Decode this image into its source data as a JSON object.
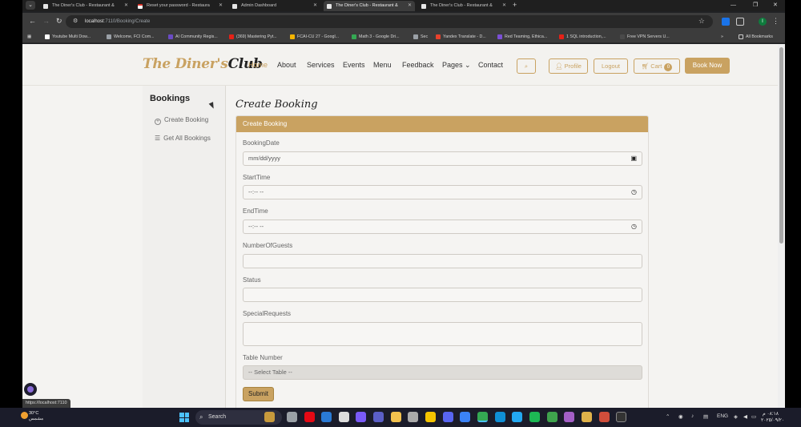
{
  "browser": {
    "tabs": [
      {
        "title": "The Diner's Club - Restaurant &",
        "active": false,
        "favicon": "doc-icon"
      },
      {
        "title": "Reset your password - Restaura",
        "active": false,
        "favicon": "gmail-icon"
      },
      {
        "title": "Admin Dashboard",
        "active": false,
        "favicon": "doc-icon"
      },
      {
        "title": "The Diner's Club - Restaurant &",
        "active": true,
        "favicon": "doc-icon"
      },
      {
        "title": "The Diner's Club - Restaurant &",
        "active": false,
        "favicon": "doc-icon"
      }
    ],
    "url_host": "localhost",
    "url_rest": ":7110/Booking/Create",
    "profile_initial": "I",
    "bookmarks": [
      {
        "label": "Youtube Multi Dow...",
        "color": "#ffffff"
      },
      {
        "label": "Welcome, FCI Com...",
        "color": "#9aa0a6"
      },
      {
        "label": "AI Community Regis...",
        "color": "#6a4bc4"
      },
      {
        "label": "(369) Mastering Pyt...",
        "color": "#e62117"
      },
      {
        "label": "FCAI-CU 27 - Googl...",
        "color": "#f4b400"
      },
      {
        "label": "Math 3 - Google Dri...",
        "color": "#34a853"
      },
      {
        "label": "Sec",
        "color": "#9aa0a6"
      },
      {
        "label": "Yandex Translate - D...",
        "color": "#e8412c"
      },
      {
        "label": "Red Teaming, Ethica...",
        "color": "#7b4fd6"
      },
      {
        "label": "1 SQL introduction,...",
        "color": "#e62117"
      },
      {
        "label": "Free VPN Servers U...",
        "color": "#4a4a4a"
      }
    ],
    "all_bookmarks": "All Bookmarks",
    "status_url": "https://localhost:7110"
  },
  "site": {
    "logo_gold": "The Diner's",
    "logo_dark": "Club",
    "nav": [
      {
        "label": "Home",
        "active": true
      },
      {
        "label": "About",
        "active": false
      },
      {
        "label": "Services",
        "active": false
      },
      {
        "label": "Events",
        "active": false
      },
      {
        "label": "Menu",
        "active": false
      },
      {
        "label": "Feedback",
        "active": false
      },
      {
        "label": "Pages",
        "active": false
      },
      {
        "label": "Contact",
        "active": false
      }
    ],
    "profile": "Profile",
    "logout": "Logout",
    "cart": "Cart",
    "cart_count": "0",
    "book_now": "Book Now",
    "accent": "#c9a261"
  },
  "sidebar": {
    "title": "Bookings",
    "items": [
      {
        "label": "Create Booking",
        "icon": "plus-circle-icon"
      },
      {
        "label": "Get All Bookings",
        "icon": "list-icon"
      }
    ]
  },
  "form": {
    "page_title": "Create Booking",
    "card_title": "Create Booking",
    "fields": [
      {
        "label": "BookingDate",
        "value": "mm/dd/yyyy",
        "icon": "calendar-icon"
      },
      {
        "label": "StartTime",
        "value": "--:-- --",
        "icon": "clock-icon"
      },
      {
        "label": "EndTime",
        "value": "--:-- --",
        "icon": "clock-icon"
      },
      {
        "label": "NumberOfGuests",
        "value": ""
      },
      {
        "label": "Status",
        "value": ""
      },
      {
        "label": "SpecialRequests",
        "value": ""
      },
      {
        "label": "Table Number",
        "value": "-- Select Table --"
      }
    ],
    "submit": "Submit"
  },
  "taskbar": {
    "temp": "30°C",
    "weather": "مشمس",
    "search": "Search",
    "lang": "ENG",
    "time": "٠٨:١٨ م",
    "date": "٢٠٢٥/٠٩/٢٠"
  }
}
